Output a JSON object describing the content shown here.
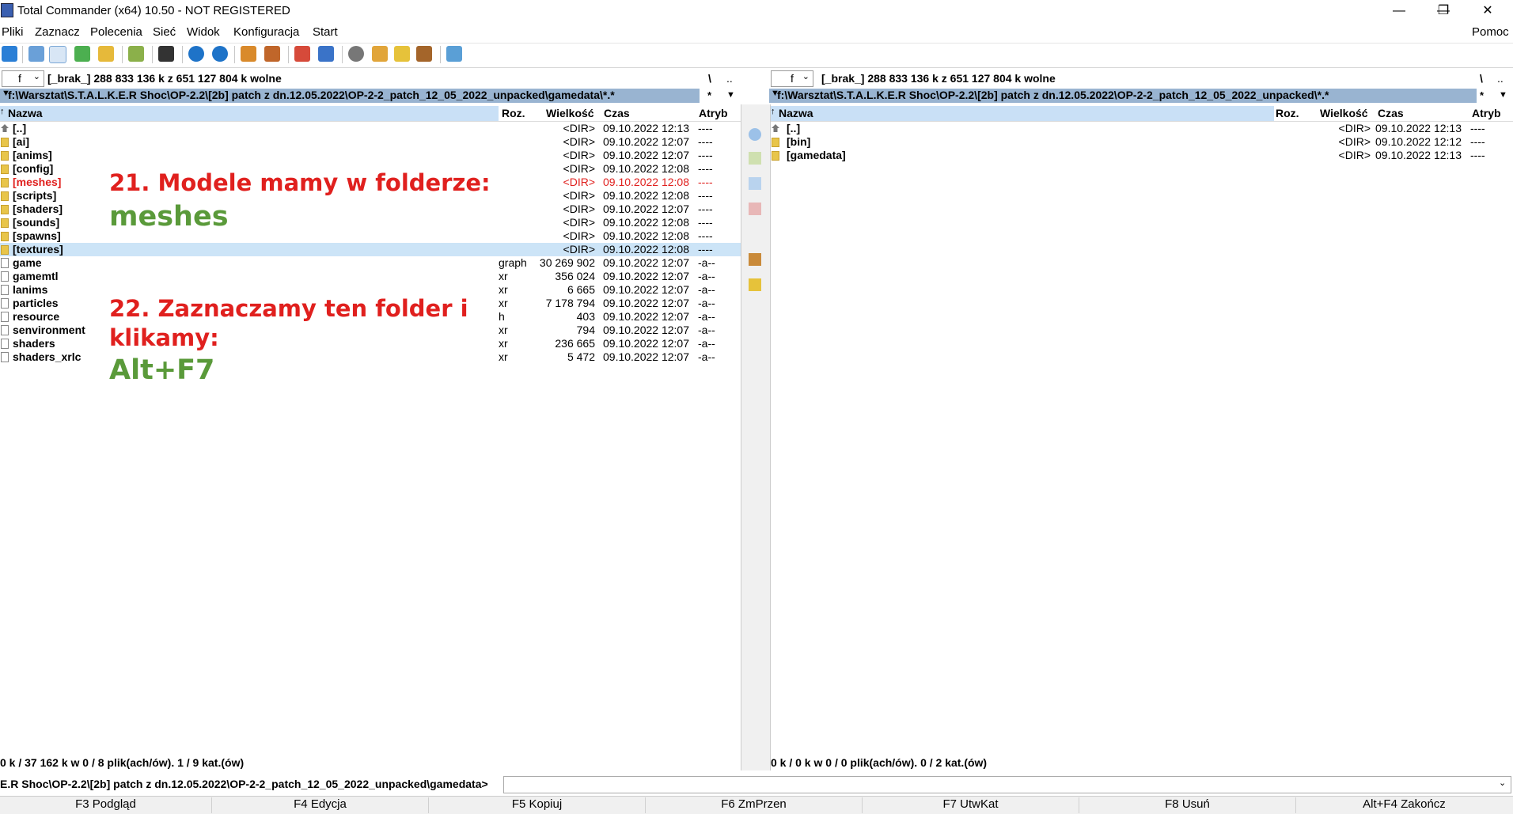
{
  "window": {
    "title": "Total Commander (x64) 10.50 - NOT REGISTERED",
    "minimize": "—",
    "restore": "❐",
    "close": "✕"
  },
  "menu": {
    "items": [
      "Pliki",
      "Zaznacz",
      "Polecenia",
      "Sieć",
      "Widok",
      "Konfiguracja",
      "Start"
    ],
    "help": "Pomoc"
  },
  "left_panel": {
    "drive": "f",
    "drive_info": "[_brak_]  288 833 136 k z 651 127 804 k wolne",
    "root_btn": "\\",
    "up_btn": "..",
    "path": "f:\\Warsztat\\S.T.A.L.K.E.R Shoc\\OP-2.2\\[2b] patch z dn.12.05.2022\\OP-2-2_patch_12_05_2022_unpacked\\gamedata\\*.*",
    "path_star": "*",
    "headers": {
      "name": "Nazwa",
      "ext": "Roz.",
      "size": "Wielkość",
      "date": "Czas",
      "attr": "Atryb"
    },
    "rows": [
      {
        "name": "[..]",
        "ext": "",
        "size": "<DIR>",
        "date": "09.10.2022 12:13",
        "attr": "----",
        "type": "up"
      },
      {
        "name": "[ai]",
        "ext": "",
        "size": "<DIR>",
        "date": "09.10.2022 12:07",
        "attr": "----",
        "type": "folder"
      },
      {
        "name": "[anims]",
        "ext": "",
        "size": "<DIR>",
        "date": "09.10.2022 12:07",
        "attr": "----",
        "type": "folder"
      },
      {
        "name": "[config]",
        "ext": "",
        "size": "<DIR>",
        "date": "09.10.2022 12:08",
        "attr": "----",
        "type": "folder"
      },
      {
        "name": "[meshes]",
        "ext": "",
        "size": "<DIR>",
        "date": "09.10.2022 12:08",
        "attr": "----",
        "type": "folder",
        "marked": true
      },
      {
        "name": "[scripts]",
        "ext": "",
        "size": "<DIR>",
        "date": "09.10.2022 12:08",
        "attr": "----",
        "type": "folder"
      },
      {
        "name": "[shaders]",
        "ext": "",
        "size": "<DIR>",
        "date": "09.10.2022 12:07",
        "attr": "----",
        "type": "folder"
      },
      {
        "name": "[sounds]",
        "ext": "",
        "size": "<DIR>",
        "date": "09.10.2022 12:08",
        "attr": "----",
        "type": "folder"
      },
      {
        "name": "[spawns]",
        "ext": "",
        "size": "<DIR>",
        "date": "09.10.2022 12:08",
        "attr": "----",
        "type": "folder"
      },
      {
        "name": "[textures]",
        "ext": "",
        "size": "<DIR>",
        "date": "09.10.2022 12:08",
        "attr": "----",
        "type": "folder",
        "cursor": true
      },
      {
        "name": "game",
        "ext": "graph",
        "size": "30 269 902",
        "date": "09.10.2022 12:07",
        "attr": "-a--",
        "type": "file"
      },
      {
        "name": "gamemtl",
        "ext": "xr",
        "size": "356 024",
        "date": "09.10.2022 12:07",
        "attr": "-a--",
        "type": "file"
      },
      {
        "name": "lanims",
        "ext": "xr",
        "size": "6 665",
        "date": "09.10.2022 12:07",
        "attr": "-a--",
        "type": "file"
      },
      {
        "name": "particles",
        "ext": "xr",
        "size": "7 178 794",
        "date": "09.10.2022 12:07",
        "attr": "-a--",
        "type": "file"
      },
      {
        "name": "resource",
        "ext": "h",
        "size": "403",
        "date": "09.10.2022 12:07",
        "attr": "-a--",
        "type": "file"
      },
      {
        "name": "senvironment",
        "ext": "xr",
        "size": "794",
        "date": "09.10.2022 12:07",
        "attr": "-a--",
        "type": "file"
      },
      {
        "name": "shaders",
        "ext": "xr",
        "size": "236 665",
        "date": "09.10.2022 12:07",
        "attr": "-a--",
        "type": "file"
      },
      {
        "name": "shaders_xrlc",
        "ext": "xr",
        "size": "5 472",
        "date": "09.10.2022 12:07",
        "attr": "-a--",
        "type": "file"
      }
    ],
    "status": "0 k / 37 162 k w 0 / 8 plik(ach/ów). 1 / 9 kat.(ów)"
  },
  "right_panel": {
    "drive": "f",
    "drive_info": "[_brak_]  288 833 136 k z 651 127 804 k wolne",
    "root_btn": "\\",
    "up_btn": "..",
    "path": "f:\\Warsztat\\S.T.A.L.K.E.R Shoc\\OP-2.2\\[2b] patch z dn.12.05.2022\\OP-2-2_patch_12_05_2022_unpacked\\*.*",
    "path_star": "*",
    "headers": {
      "name": "Nazwa",
      "ext": "Roz.",
      "size": "Wielkość",
      "date": "Czas",
      "attr": "Atryb"
    },
    "rows": [
      {
        "name": "[..]",
        "ext": "",
        "size": "<DIR>",
        "date": "09.10.2022 12:13",
        "attr": "----",
        "type": "up"
      },
      {
        "name": "[bin]",
        "ext": "",
        "size": "<DIR>",
        "date": "09.10.2022 12:12",
        "attr": "----",
        "type": "folder"
      },
      {
        "name": "[gamedata]",
        "ext": "",
        "size": "<DIR>",
        "date": "09.10.2022 12:13",
        "attr": "----",
        "type": "folder"
      }
    ],
    "status": "0 k / 0 k w 0 / 0 plik(ach/ów). 0 / 2 kat.(ów)"
  },
  "command_line": {
    "prompt": "E.R Shoc\\OP-2.2\\[2b] patch z dn.12.05.2022\\OP-2-2_patch_12_05_2022_unpacked\\gamedata>",
    "value": ""
  },
  "function_keys": [
    "F3 Podgląd",
    "F4 Edycja",
    "F5 Kopiuj",
    "F6 ZmPrzen",
    "F7 UtwKat",
    "F8 Usuń",
    "Alt+F4 Zakończ"
  ],
  "annotations": {
    "step21": "21. Modele mamy w folderze:",
    "step21_highlight": "meshes",
    "step22_line1": "22. Zaznaczamy ten folder i",
    "step22_line2": "klikamy:",
    "step22_highlight": "Alt+F7"
  },
  "colors": {
    "path_bar": "#99b4d1",
    "header_highlight": "#c9e0f6",
    "marked_text": "#e0201e",
    "annotation_red": "#e0201e",
    "annotation_green": "#5a9a3a"
  }
}
